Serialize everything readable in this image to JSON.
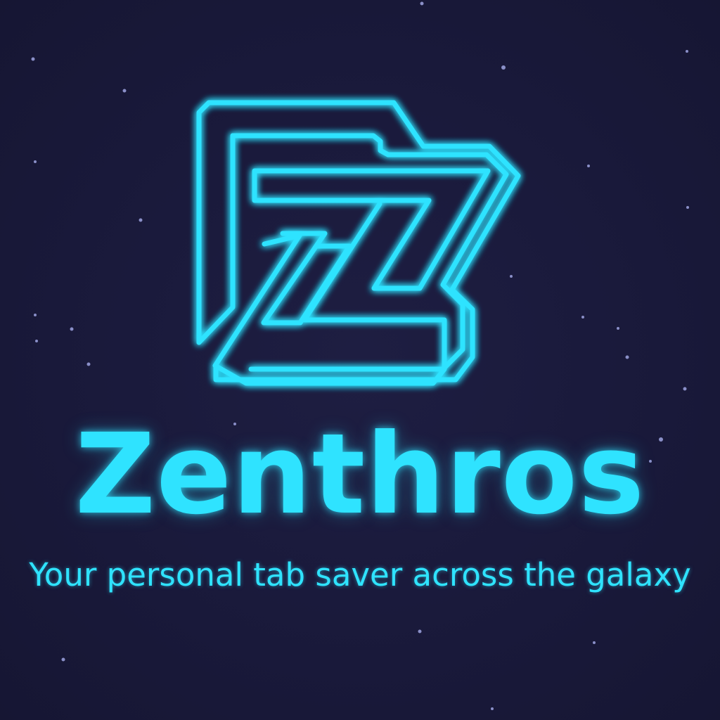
{
  "brand": {
    "name": "Zenthros",
    "tagline": "Your personal tab saver across the galaxy",
    "logo_icon": "folder-z-logo-icon"
  },
  "colors": {
    "background": "#1a1a38",
    "accent": "#2fe3ff",
    "star": "#8a8fc8"
  }
}
